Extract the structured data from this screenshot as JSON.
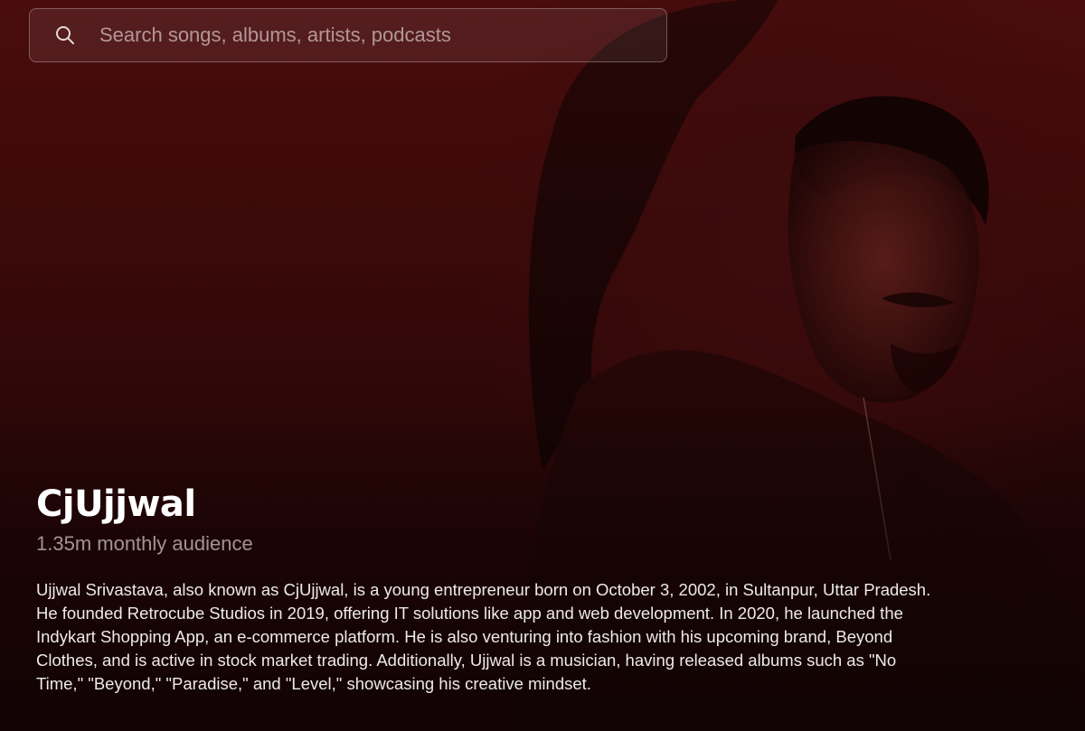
{
  "search": {
    "placeholder": "Search songs, albums, artists, podcasts",
    "icon": "search-icon"
  },
  "artist": {
    "name": "CjUjjwal",
    "monthly_audience": "1.35m monthly audience",
    "bio": "Ujjwal Srivastava, also known as CjUjjwal, is a young entrepreneur born on October 3, 2002, in Sultanpur, Uttar Pradesh. He founded Retrocube Studios in 2019, offering IT solutions like app and web development. In 2020, he launched the Indykart Shopping App, an e-commerce platform. He is also venturing into fashion with his upcoming brand, Beyond Clothes, and is active in stock market trading. Additionally, Ujjwal is a musician, having released albums such as \"No Time,\" \"Beyond,\" \"Paradise,\" and \"Level,\" showcasing his creative mindset."
  },
  "colors": {
    "background": "#3a0909",
    "text_primary": "#ffffff",
    "text_secondary": "#b8aeae"
  }
}
